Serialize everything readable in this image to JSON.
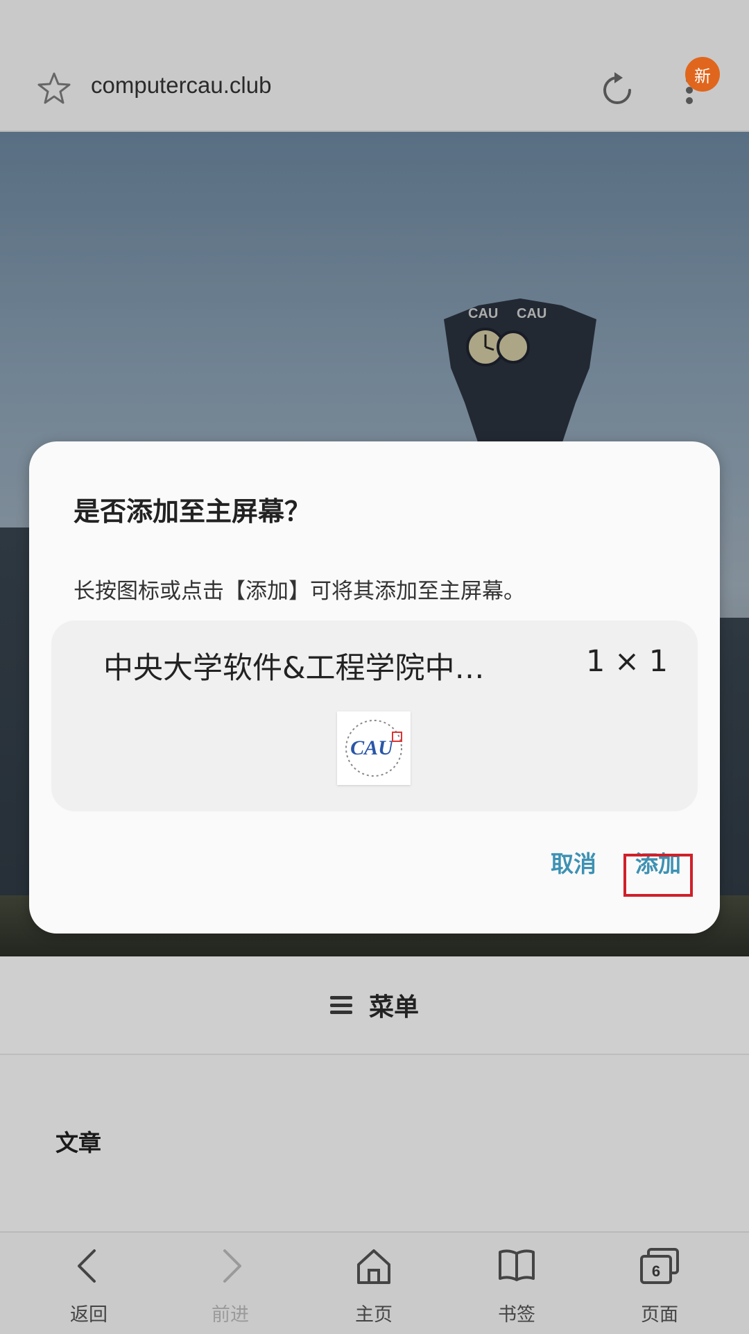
{
  "browser": {
    "url": "computercau.club",
    "badge": "新",
    "icons": {
      "bookmark": "star-icon",
      "reload": "reload-icon",
      "more": "more-vertical-icon"
    }
  },
  "page": {
    "menu_label": "菜单",
    "article_heading": "文章",
    "hero_sign": "CAU"
  },
  "dialog": {
    "title": "是否添加至主屏幕？",
    "message": "长按图标或点击【添加】可将其添加至主屏幕。",
    "app_name": "中央大学软件&工程学院中…",
    "app_size": "1 × 1",
    "logo_text": "CAU",
    "cancel_label": "取消",
    "add_label": "添加"
  },
  "bottom_nav": {
    "items": [
      {
        "label": "返回",
        "icon": "back-icon"
      },
      {
        "label": "前进",
        "icon": "forward-icon"
      },
      {
        "label": "主页",
        "icon": "home-icon"
      },
      {
        "label": "书签",
        "icon": "bookmarks-icon"
      },
      {
        "label": "页面",
        "icon": "tabs-icon"
      }
    ],
    "tab_count": "6"
  },
  "colors": {
    "accent": "#3d91b3",
    "badge": "#e0661d",
    "highlight": "#d0202a"
  }
}
